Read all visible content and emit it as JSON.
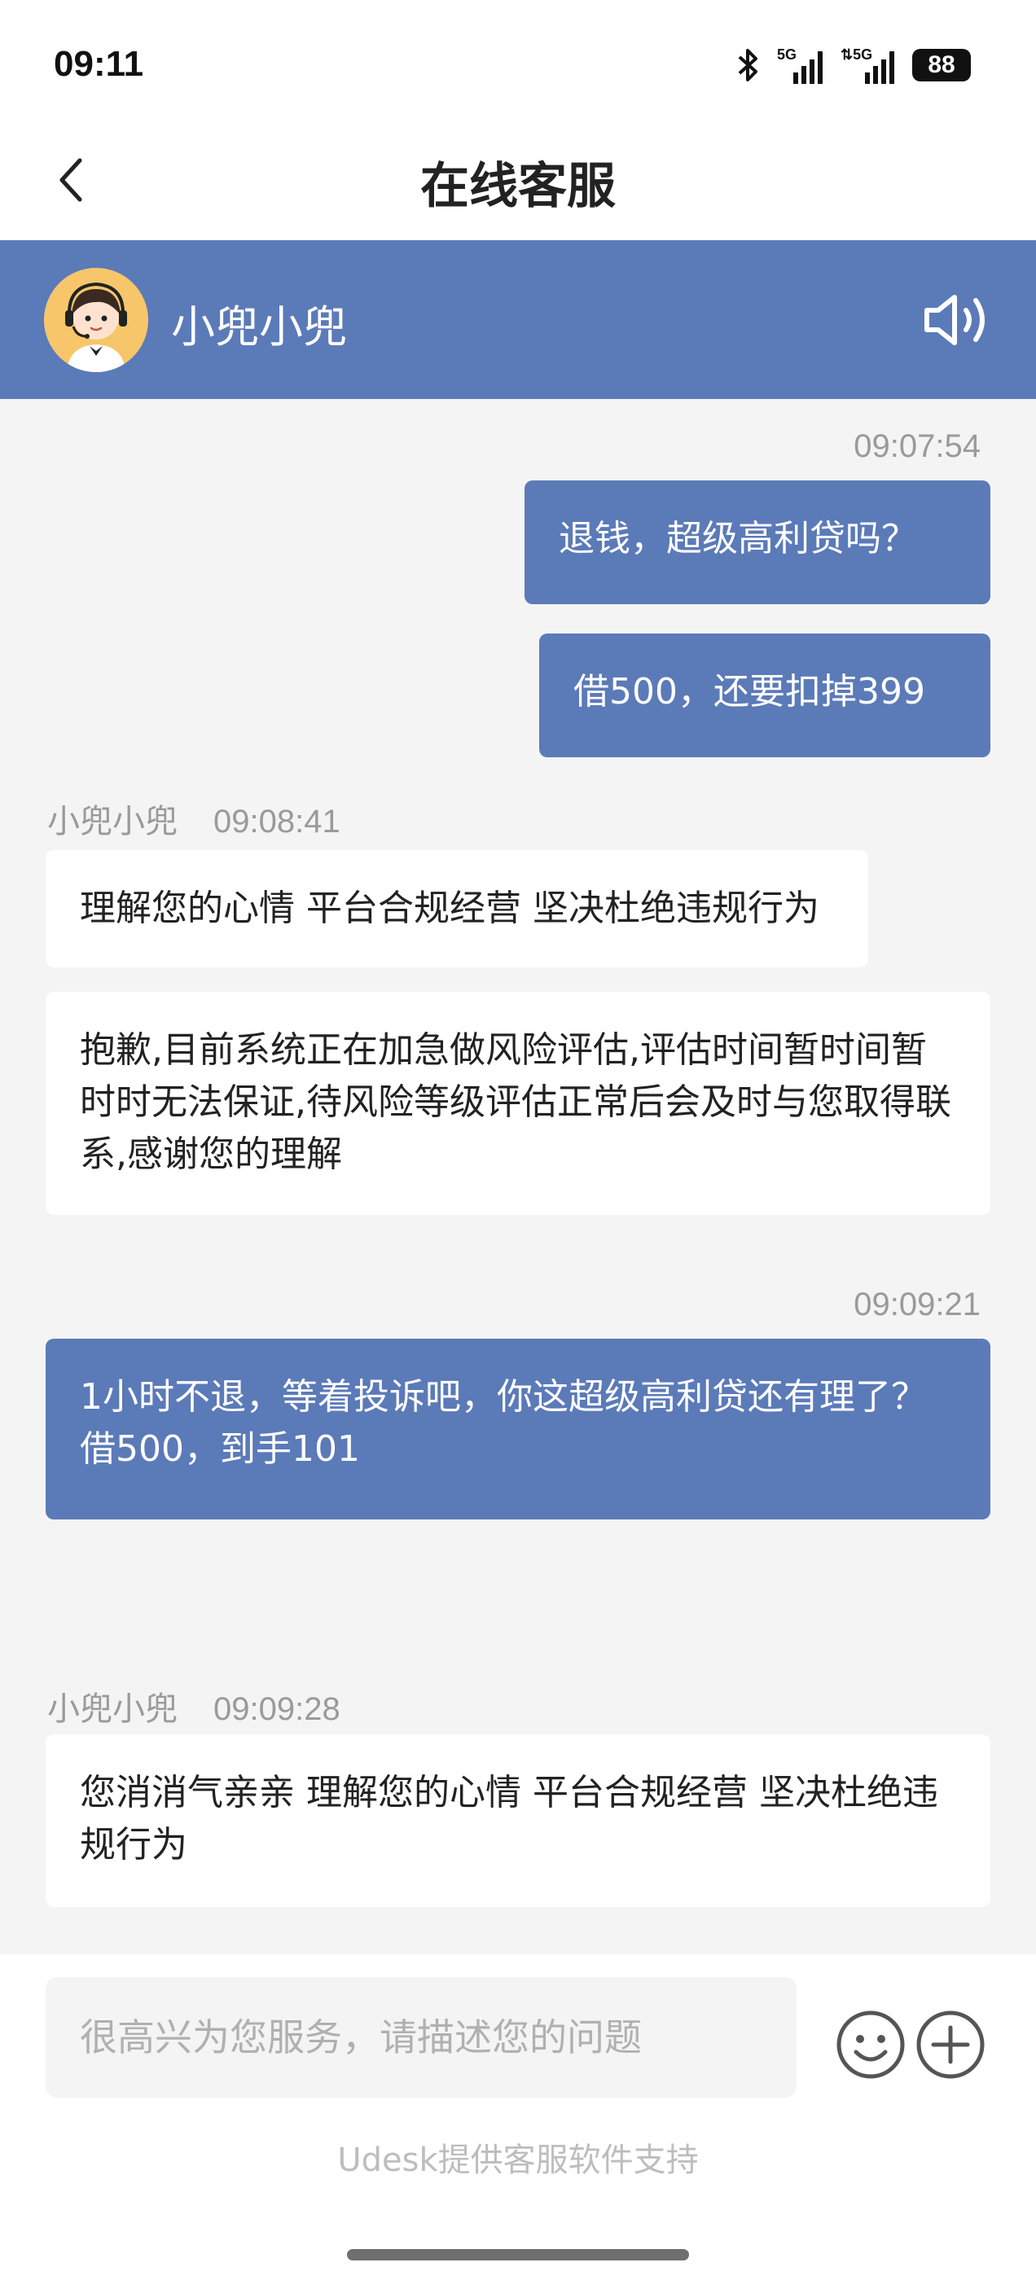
{
  "status_bar": {
    "time": "09:11",
    "battery": "88",
    "icons": [
      "bluetooth-icon",
      "signal-5g-icon",
      "signal-5g-icon",
      "battery-icon"
    ]
  },
  "nav": {
    "title": "在线客服",
    "back_icon": "chevron-left-icon"
  },
  "agent": {
    "name": "小兜小兜",
    "avatar": "customer-service-avatar",
    "speaker_icon": "speaker-icon"
  },
  "colors": {
    "brand": "#5b7ab8",
    "background": "#f4f4f4",
    "bubble_in": "#ffffff",
    "timestamp": "#9a9a9a"
  },
  "messages": [
    {
      "sender": "user",
      "time": "09:07:54"
    },
    {
      "sender": "user",
      "text": "退钱，超级高利贷吗？"
    },
    {
      "sender": "user",
      "text": "借500，还要扣掉399"
    },
    {
      "sender": "agent",
      "name": "小兜小兜",
      "time": "09:08:41"
    },
    {
      "sender": "agent",
      "text": "理解您的心情 平台合规经营 坚决杜绝违规行为"
    },
    {
      "sender": "agent",
      "text": "抱歉,目前系统正在加急做风险评估,评估时间暂时间暂时时无法保证,待风险等级评估正常后会及时与您取得联系,感谢您的理解"
    },
    {
      "sender": "user",
      "time": "09:09:21"
    },
    {
      "sender": "user",
      "text": "1小时不退，等着投诉吧，你这超级高利贷还有理了？借500，到手101"
    },
    {
      "sender": "agent",
      "name": "小兜小兜",
      "time": "09:09:28"
    },
    {
      "sender": "agent",
      "text": "您消消气亲亲 理解您的心情 平台合规经营 坚决杜绝违规行为"
    }
  ],
  "input": {
    "placeholder": "很高兴为您服务，请描述您的问题",
    "value": ""
  },
  "toolbar": {
    "emoji_icon": "emoji-icon",
    "plus_icon": "plus-icon"
  },
  "footer": {
    "note": "Udesk提供客服软件支持"
  }
}
